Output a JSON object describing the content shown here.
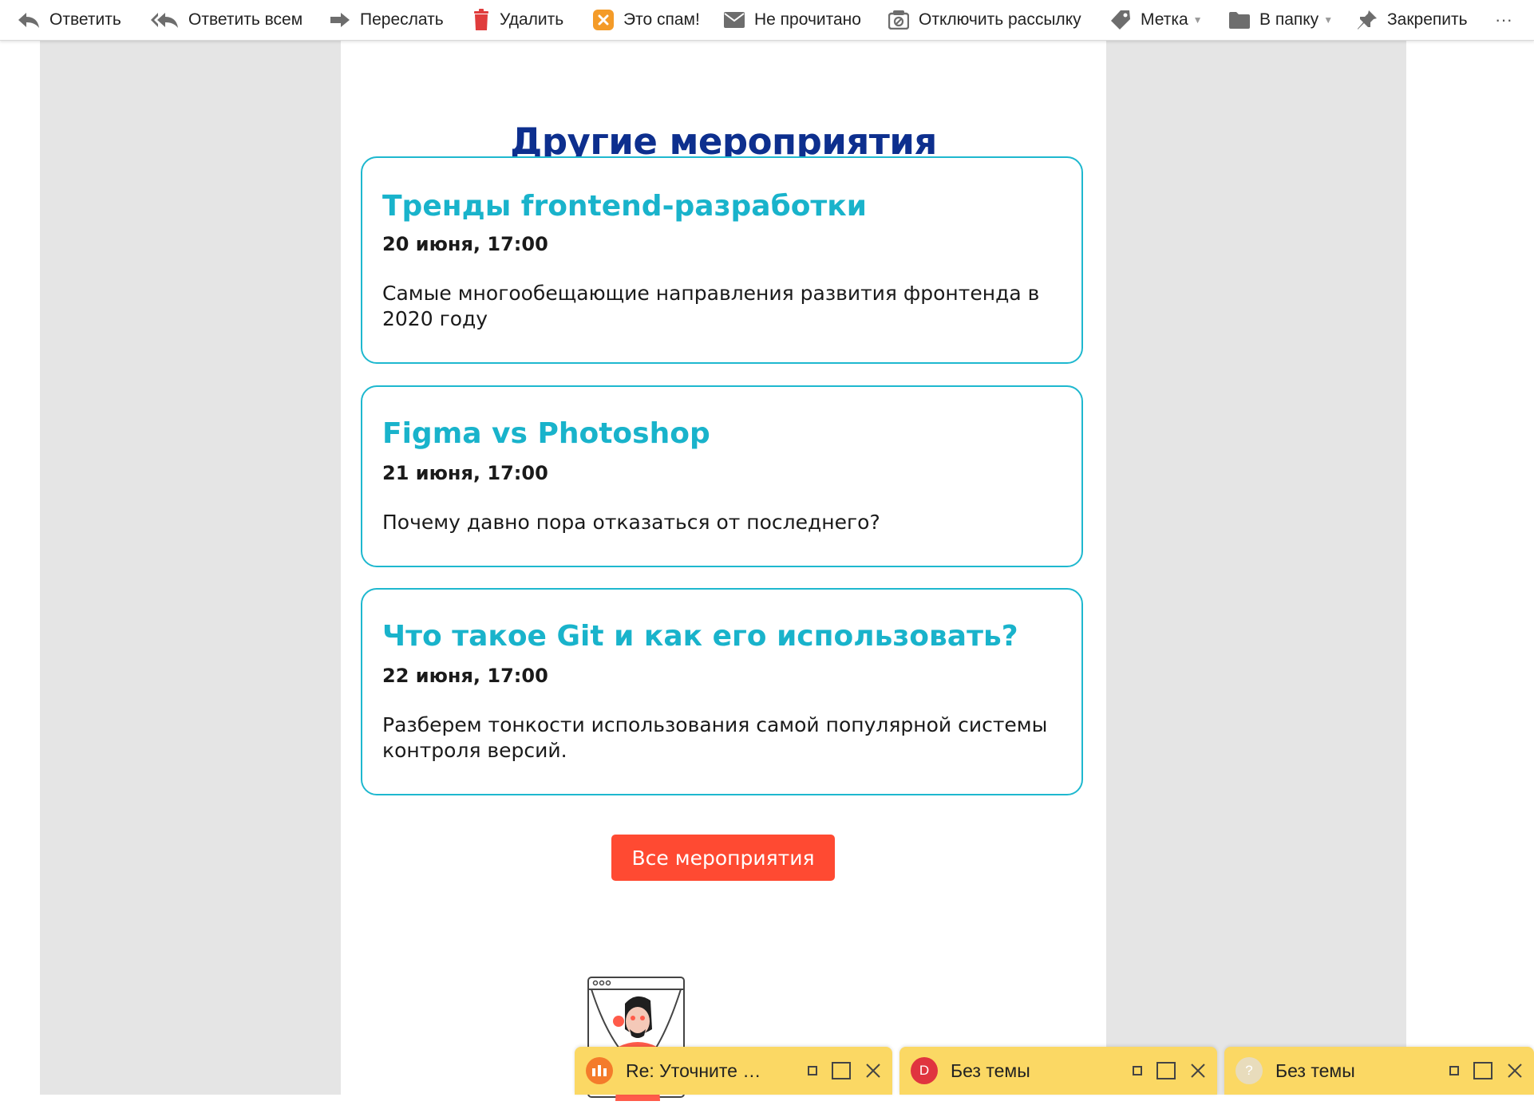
{
  "toolbar": {
    "reply": "Ответить",
    "reply_all": "Ответить всем",
    "forward": "Переслать",
    "delete": "Удалить",
    "spam": "Это спам!",
    "unread": "Не прочитано",
    "unsubscribe": "Отключить рассылку",
    "label": "Метка",
    "to_folder": "В папку",
    "pin": "Закрепить",
    "more": "···"
  },
  "email": {
    "heading": "Другие мероприятия",
    "events": [
      {
        "title": "Тренды frontend-разработки",
        "date": "20 июня, 17:00",
        "description": "Самые многообещающие направления развития фронтенда в 2020 году"
      },
      {
        "title": "Figma vs Photoshop",
        "date": "21 июня, 17:00",
        "description": "Почему давно пора отказаться от последнего?"
      },
      {
        "title": "Что такое Git и как его использовать?",
        "date": "22 июня, 17:00",
        "description": "Разберем тонкости использования самой популярной системы контроля версий."
      }
    ],
    "cta_label": "Все мероприятия"
  },
  "compose_windows": [
    {
      "title": "Re: Уточните п...",
      "avatar_letter": "",
      "avatar_color": "#f47b2b"
    },
    {
      "title": "Без темы",
      "avatar_letter": "D",
      "avatar_color": "#e0343f"
    },
    {
      "title": "Без темы",
      "avatar_letter": "?",
      "avatar_color": "#e8dcbc"
    }
  ],
  "colors": {
    "heading": "#0d2f8e",
    "event_title": "#19b3cb",
    "event_border": "#1eb8cf",
    "cta": "#ff4a32",
    "compose_bg": "#fbd864"
  }
}
